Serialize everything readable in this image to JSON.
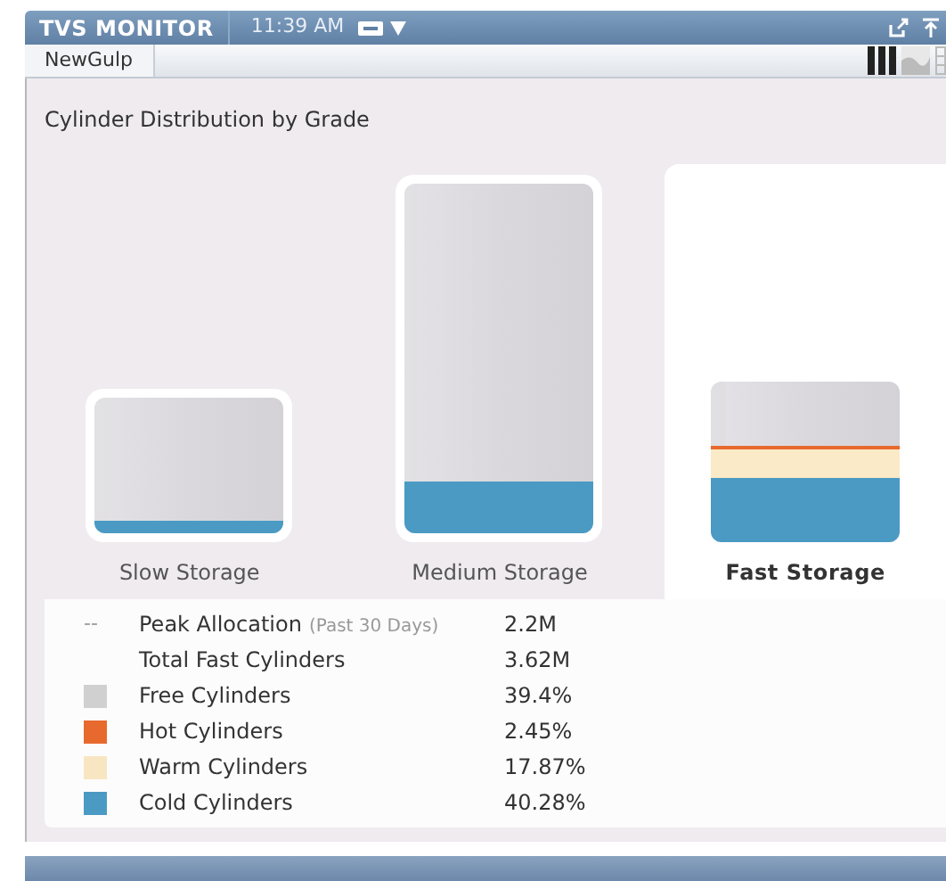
{
  "window": {
    "title": "TVS MONITOR",
    "time": "11:39 AM"
  },
  "toolbar": {
    "tabs": [
      {
        "label": "NewGulp",
        "selected": true
      }
    ],
    "views": [
      {
        "kind": "bars",
        "selected": true
      },
      {
        "kind": "area",
        "selected": false
      },
      {
        "kind": "grid",
        "selected": false
      }
    ]
  },
  "chart": {
    "title": "Cylinder Distribution by Grade",
    "cylinders": [
      {
        "name": "Slow Storage",
        "selected": false,
        "segments": [
          {
            "color": "#4a9ac4",
            "level": 0.09
          }
        ]
      },
      {
        "name": "Medium Storage",
        "selected": false,
        "segments": [
          {
            "color": "#4a9ac4",
            "level": 0.15
          }
        ]
      },
      {
        "name": "Fast Storage",
        "selected": true,
        "segments": [
          {
            "color": "#4a9ac4",
            "level": 0.4028
          },
          {
            "color": "#fbeac7",
            "level": 0.1787
          },
          {
            "color": "#e8692e",
            "level": 0.0245
          }
        ]
      }
    ]
  },
  "legend": [
    {
      "kind": "dash",
      "symbol": "--",
      "label": "Peak Allocation",
      "note": "(Past 30 Days)",
      "value": "2.2M"
    },
    {
      "kind": "plain",
      "label": "Total Fast Cylinders",
      "value": "3.62M"
    },
    {
      "kind": "swatch",
      "color": "#d0d0d0",
      "label": "Free Cylinders",
      "value": "39.4%"
    },
    {
      "kind": "swatch",
      "color": "#e8692e",
      "label": "Hot Cylinders",
      "value": "2.45%"
    },
    {
      "kind": "swatch",
      "color": "#f8e6c2",
      "label": "Warm Cylinders",
      "value": "17.87%"
    },
    {
      "kind": "swatch",
      "color": "#4a9ac4",
      "label": "Cold Cylinders",
      "value": "40.28%"
    }
  ]
}
